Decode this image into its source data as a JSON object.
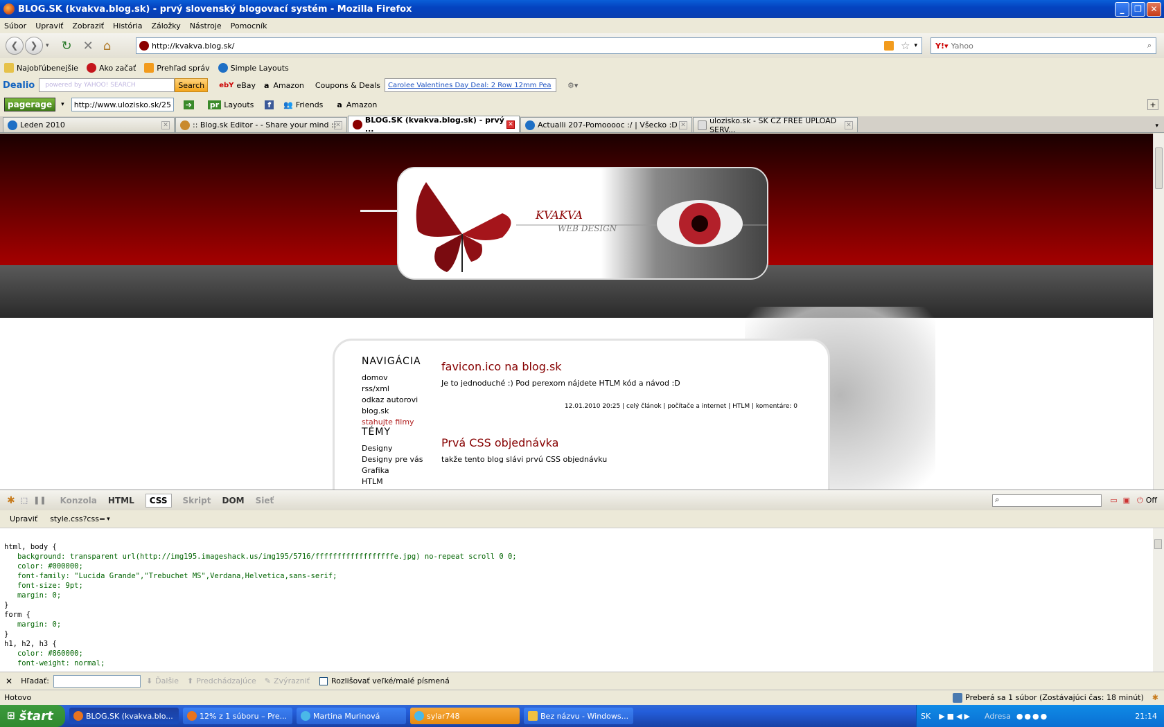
{
  "window": {
    "title": "BLOG.SK (kvakva.blog.sk) - prvý slovenský blogovací systém - Mozilla Firefox"
  },
  "menu": [
    "Súbor",
    "Upraviť",
    "Zobraziť",
    "História",
    "Záložky",
    "Nástroje",
    "Pomocník"
  ],
  "url": "http://kvakva.blog.sk/",
  "search_placeholder": "Yahoo",
  "bookmarks": [
    "Najobľúbenejšie",
    "Ako začať",
    "Prehľad správ",
    "Simple Layouts"
  ],
  "dealio": {
    "brand": "Dealio",
    "search_hint": "powered by YAHOO! SEARCH",
    "search_btn": "Search",
    "ebay": "eBay",
    "amazon": "Amazon",
    "coupons": "Coupons & Deals",
    "deal_link": "Carolee Valentines Day Deal: 2 Row 12mm Pea"
  },
  "pagerage": {
    "brand": "pagerage",
    "url": "http://www.ulozisko.sk/25",
    "layouts": "Layouts",
    "friends": "Friends",
    "amazon": "Amazon"
  },
  "tabs": [
    "Leden 2010",
    ":: Blog.sk Editor - - Share your mind ::",
    "BLOG.SK (kvakva.blog.sk) - prvý ...",
    "Actualli 207-Pomooooc :/ | Všecko :D",
    "ulozisko.sk - SK CZ FREE UPLOAD SERV..."
  ],
  "page": {
    "logo_title": "KVAKVA",
    "logo_sub": "WEB DESIGN",
    "nav_heading": "NAVIGÁCIA",
    "nav_links": [
      "domov",
      "rss/xml",
      "odkaz autorovi",
      "blog.sk",
      "stahujte filmy"
    ],
    "topics_heading": "TÉMY",
    "topics": [
      "Designy",
      "Designy pre vás",
      "Grafika",
      "HTLM"
    ],
    "posts": [
      {
        "title": "favicon.ico na blog.sk",
        "text": "Je to jednoduché :) Pod perexom nájdete HTLM kód a návod :D",
        "meta": "12.01.2010 20:25 | celý článok | počítače a internet | HTLM | komentáre: 0"
      },
      {
        "title": "Prvá CSS objednávka",
        "text": "takže tento blog slávi prvú CSS objednávku"
      }
    ]
  },
  "firebug": {
    "tabs": [
      "Konzola",
      "HTML",
      "CSS",
      "Skript",
      "DOM",
      "Sieť"
    ],
    "edit": "Upraviť",
    "file": "style.css?css=",
    "off": "Off",
    "css_lines": [
      "html, body {",
      "   background: transparent url(http://img195.imageshack.us/img195/5716/ffffffffffffffffffe.jpg) no-repeat scroll 0 0;",
      "   color: #000000;",
      "   font-family: \"Lucida Grande\",\"Trebuchet MS\",Verdana,Helvetica,sans-serif;",
      "   font-size: 9pt;",
      "   margin: 0;",
      "}",
      "",
      "form {",
      "   margin: 0;",
      "}",
      "",
      "h1, h2, h3 {",
      "   color: #860000;",
      "   font-weight: normal;"
    ]
  },
  "findbar": {
    "label": "Hľadať:",
    "next": "Ďalšie",
    "prev": "Predchádzajúce",
    "highlight": "Zvýrazniť",
    "case": "Rozlišovať veľké/malé písmená"
  },
  "status": {
    "left": "Hotovo",
    "right": "Preberá sa 1 súbor (Zostávajúci čas: 18 minút)"
  },
  "taskbar": {
    "start": "štart",
    "items": [
      "BLOG.SK (kvakva.blo...",
      "12% z 1 súboru – Pre...",
      "Martina Murinová",
      "sylar748",
      "Bez názvu - Windows..."
    ],
    "lang": "SK",
    "address": "Adresa",
    "clock": "21:14"
  }
}
